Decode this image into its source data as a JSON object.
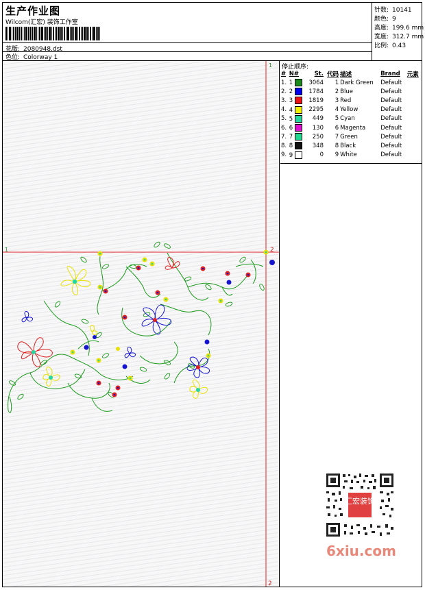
{
  "header": {
    "title": "生产作业图",
    "company": "Wilcom(汇宏) 装饰工作室",
    "pattern_label": "花版:",
    "pattern_value": "2080948.dst",
    "colorway_label": "色位:",
    "colorway_value": "Colorway 1"
  },
  "stats": [
    {
      "label": "针数:",
      "value": "10141"
    },
    {
      "label": "颜色:",
      "value": "9"
    },
    {
      "label": "高度:",
      "value": "199.6 mm"
    },
    {
      "label": "宽度:",
      "value": "312.7 mm"
    },
    {
      "label": "比例:",
      "value": "0.43"
    }
  ],
  "design": {
    "markers": {
      "top": "1",
      "left": "1",
      "right": "2",
      "bottom": "2"
    }
  },
  "stop_sequence": {
    "title": "停止顺序:",
    "columns": [
      "#",
      "N#",
      "St.",
      "代码",
      "描述",
      "Brand",
      "元素"
    ],
    "rows": [
      {
        "idx": "1.",
        "n": "1",
        "color": "#1a8a1a",
        "st": "3064",
        "code": "1",
        "desc": "Dark Green",
        "brand": "Default"
      },
      {
        "idx": "2.",
        "n": "2",
        "color": "#0000ee",
        "st": "1784",
        "code": "2",
        "desc": "Blue",
        "brand": "Default"
      },
      {
        "idx": "3.",
        "n": "3",
        "color": "#ee1111",
        "st": "1819",
        "code": "3",
        "desc": "Red",
        "brand": "Default"
      },
      {
        "idx": "4.",
        "n": "4",
        "color": "#f0f000",
        "st": "2295",
        "code": "4",
        "desc": "Yellow",
        "brand": "Default"
      },
      {
        "idx": "5.",
        "n": "5",
        "color": "#22d8a0",
        "st": "449",
        "code": "5",
        "desc": "Cyan",
        "brand": "Default"
      },
      {
        "idx": "6.",
        "n": "6",
        "color": "#e010d0",
        "st": "130",
        "code": "6",
        "desc": "Magenta",
        "brand": "Default"
      },
      {
        "idx": "7.",
        "n": "7",
        "color": "#20d890",
        "st": "250",
        "code": "7",
        "desc": "Green",
        "brand": "Default"
      },
      {
        "idx": "8.",
        "n": "8",
        "color": "#111111",
        "st": "348",
        "code": "8",
        "desc": "Black",
        "brand": "Default"
      },
      {
        "idx": "9.",
        "n": "9",
        "color": "#ffffff",
        "st": "0",
        "code": "9",
        "desc": "White",
        "brand": "Default"
      }
    ]
  },
  "qr_stamp": "汇宏装饰",
  "watermark": "6xiu.com"
}
